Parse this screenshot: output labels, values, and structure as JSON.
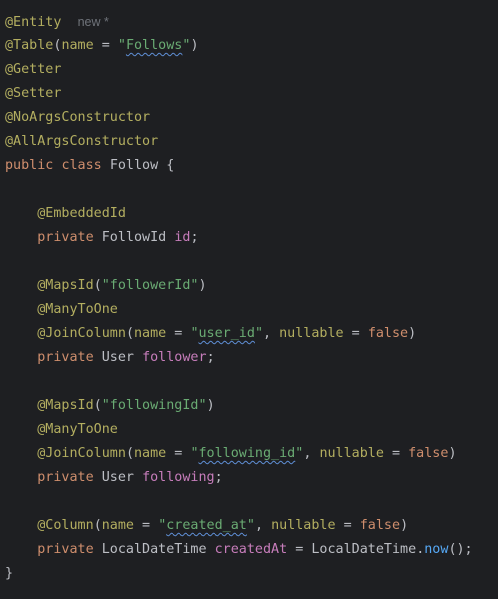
{
  "code": {
    "l1": {
      "ann": "@Entity",
      "inlay": "new *"
    },
    "l2": {
      "ann": "@Table",
      "open": "(",
      "param": "name",
      "eq": " = ",
      "q1": "\"",
      "val": "Follows",
      "q2": "\"",
      "close": ")"
    },
    "l3": {
      "ann": "@Getter"
    },
    "l4": {
      "ann": "@Setter"
    },
    "l5": {
      "ann": "@NoArgsConstructor"
    },
    "l6": {
      "ann": "@AllArgsConstructor"
    },
    "l7": {
      "kw1": "public",
      "kw2": "class",
      "name": "Follow",
      "brace": "{"
    },
    "l9": {
      "ann": "@EmbeddedId"
    },
    "l10": {
      "kw": "private",
      "type": "FollowId",
      "field": "id",
      "semi": ";"
    },
    "l12": {
      "ann": "@MapsId",
      "open": "(",
      "str": "\"followerId\"",
      "close": ")"
    },
    "l13": {
      "ann": "@ManyToOne"
    },
    "l14": {
      "ann": "@JoinColumn",
      "open": "(",
      "param1": "name",
      "eq1": " = ",
      "q1": "\"",
      "val": "user_id",
      "q2": "\"",
      "comma": ", ",
      "param2": "nullable",
      "eq2": " = ",
      "bool": "false",
      "close": ")"
    },
    "l15": {
      "kw": "private",
      "type": "User",
      "field": "follower",
      "semi": ";"
    },
    "l17": {
      "ann": "@MapsId",
      "open": "(",
      "str": "\"followingId\"",
      "close": ")"
    },
    "l18": {
      "ann": "@ManyToOne"
    },
    "l19": {
      "ann": "@JoinColumn",
      "open": "(",
      "param1": "name",
      "eq1": " = ",
      "q1": "\"",
      "val": "following_id",
      "q2": "\"",
      "comma": ", ",
      "param2": "nullable",
      "eq2": " = ",
      "bool": "false",
      "close": ")"
    },
    "l20": {
      "kw": "private",
      "type": "User",
      "field": "following",
      "semi": ";"
    },
    "l22": {
      "ann": "@Column",
      "open": "(",
      "param1": "name",
      "eq1": " = ",
      "q1": "\"",
      "val": "created_at",
      "q2": "\"",
      "comma": ", ",
      "param2": "nullable",
      "eq2": " = ",
      "bool": "false",
      "close": ")"
    },
    "l23": {
      "kw": "private",
      "type": "LocalDateTime",
      "field": "createdAt",
      "eq": " = ",
      "cls": "LocalDateTime",
      "dot": ".",
      "method": "now",
      "call": "();"
    },
    "l24": {
      "brace": "}"
    }
  }
}
